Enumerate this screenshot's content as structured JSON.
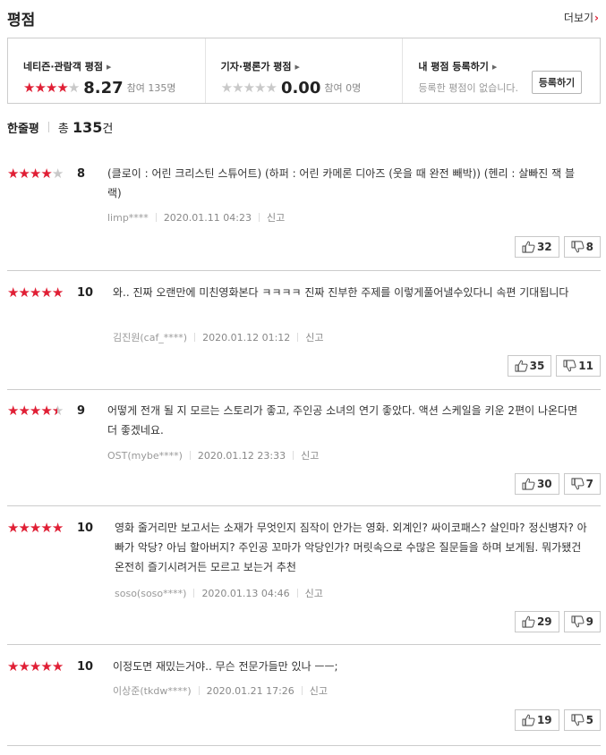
{
  "header": {
    "title": "평점",
    "more_label": "더보기",
    "more_chevron": "›"
  },
  "summary": {
    "netizen": {
      "label": "네티즌·관람객 평점",
      "rating": 4,
      "score": "8.27",
      "count": "참여 135명"
    },
    "critic": {
      "label": "기자·평론가 평점",
      "rating": 0,
      "score": "0.00",
      "count": "참여 0명"
    },
    "mine": {
      "label": "내 평점 등록하기",
      "desc": "등록한 평점이 없습니다.",
      "button": "등록하기"
    }
  },
  "reviews_header": {
    "title": "한줄평",
    "total_prefix": "총",
    "total_count": "135",
    "total_suffix": "건"
  },
  "reviews": [
    {
      "rating": 4,
      "score": "8",
      "text": "(클로이 : 어린 크리스틴 스튜어트) (하퍼 : 어린 카메론 디아즈 (웃을 때 완전 빼박)) (헨리 : 살빠진 잭 블랙)",
      "author": "limp****",
      "date": "2020.01.11 04:23",
      "report": "신고",
      "up": "32",
      "down": "8"
    },
    {
      "rating": 5,
      "score": "10",
      "text": "와.. 진짜 오랜만에 미친영화본다 ㅋㅋㅋㅋ 진짜 진부한 주제를 이렇게풀어낼수있다니 속편 기대됩니다",
      "author": "김진원(caf_****)",
      "date": "2020.01.12 01:12",
      "report": "신고",
      "up": "35",
      "down": "11"
    },
    {
      "rating": 4.5,
      "score": "9",
      "text": "어떻게 전개 될 지 모르는 스토리가 좋고, 주인공 소녀의 연기 좋았다. 액션 스케일을 키운 2편이 나온다면 더 좋겠네요.",
      "author": "OST(mybe****)",
      "date": "2020.01.12 23:33",
      "report": "신고",
      "up": "30",
      "down": "7"
    },
    {
      "rating": 5,
      "score": "10",
      "text": "영화 줄거리만 보고서는 소재가 무엇인지 짐작이 안가는 영화. 외계인? 싸이코패스? 살인마? 정신병자? 아빠가 악당? 아님 할아버지? 주인공 꼬마가 악당인가? 머릿속으로 수많은 질문들을 하며 보게됨. 뭐가됐건 온전히 즐기시려거든 모르고 보는거 추천",
      "author": "soso(soso****)",
      "date": "2020.01.13 04:46",
      "report": "신고",
      "up": "29",
      "down": "9"
    },
    {
      "rating": 5,
      "score": "10",
      "text": "이정도면 재밌는거야.. 무슨 전문가들만 있나 ㅡㅡ;",
      "author": "이상준(tkdw****)",
      "date": "2020.01.21 17:26",
      "report": "신고",
      "up": "19",
      "down": "5"
    }
  ],
  "colors": {
    "accent": "#e01f35",
    "star_off": "#c9c9c9",
    "border": "#cccccc"
  },
  "icons": {
    "vote_up": "thumbs-up-icon",
    "vote_down": "thumbs-down-icon",
    "star": "star-icon"
  }
}
